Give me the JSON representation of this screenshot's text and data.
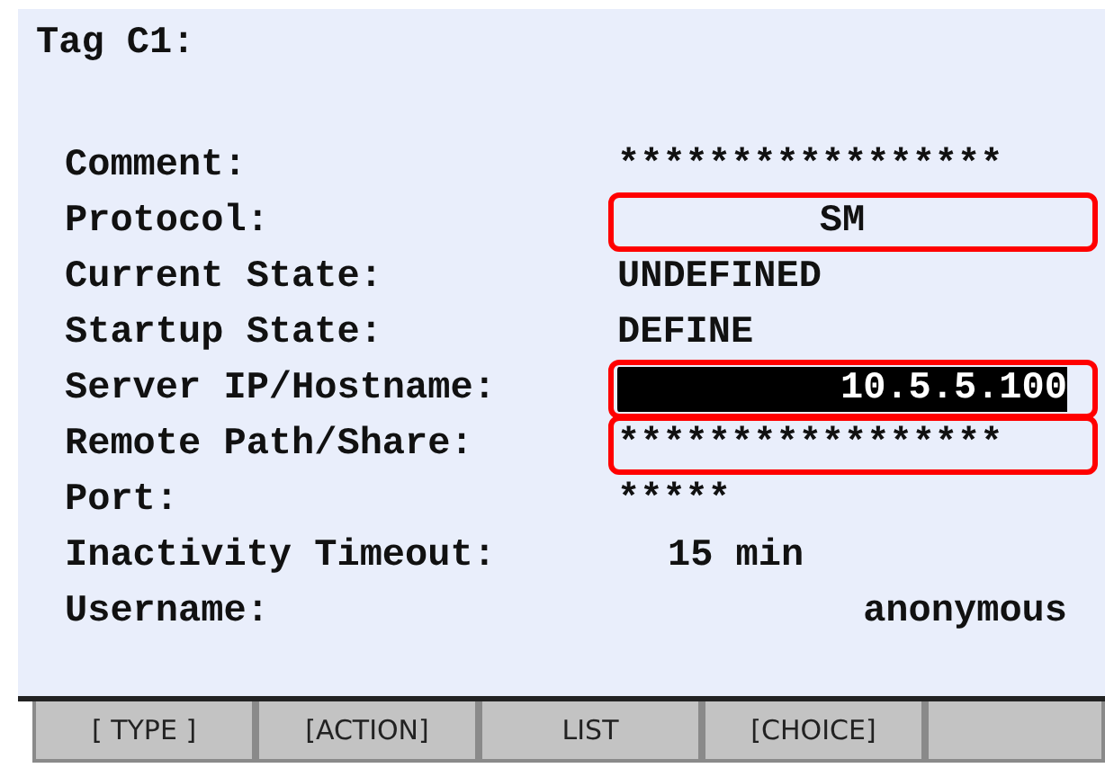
{
  "screen": {
    "title": "Tag C1:",
    "fields": [
      {
        "label": "Comment:",
        "value": "*****************",
        "kind": "masked",
        "selected": false,
        "highlighted": false
      },
      {
        "label": "Protocol:",
        "value": "SM",
        "kind": "choice",
        "selected": false,
        "highlighted": true
      },
      {
        "label": "Current State:",
        "value": "UNDEFINED",
        "kind": "state",
        "selected": false,
        "highlighted": false
      },
      {
        "label": "Startup State:",
        "value": "DEFINE",
        "kind": "state",
        "selected": false,
        "highlighted": false
      },
      {
        "label": "Server IP/Hostname:",
        "value": "10.5.5.100",
        "kind": "string",
        "selected": true,
        "highlighted": true
      },
      {
        "label": "Remote Path/Share:",
        "value": "*****************",
        "kind": "masked",
        "selected": false,
        "highlighted": true
      },
      {
        "label": "Port:",
        "value": "*****",
        "kind": "masked",
        "selected": false,
        "highlighted": false
      },
      {
        "label": "Inactivity Timeout:",
        "value": "15 min",
        "kind": "number",
        "selected": false,
        "highlighted": false
      },
      {
        "label": "Username:",
        "value": "anonymous",
        "kind": "string",
        "selected": false,
        "highlighted": false
      }
    ]
  },
  "function_keys": [
    "[ TYPE ]",
    "[ACTION]",
    "LIST",
    "[CHOICE]"
  ]
}
